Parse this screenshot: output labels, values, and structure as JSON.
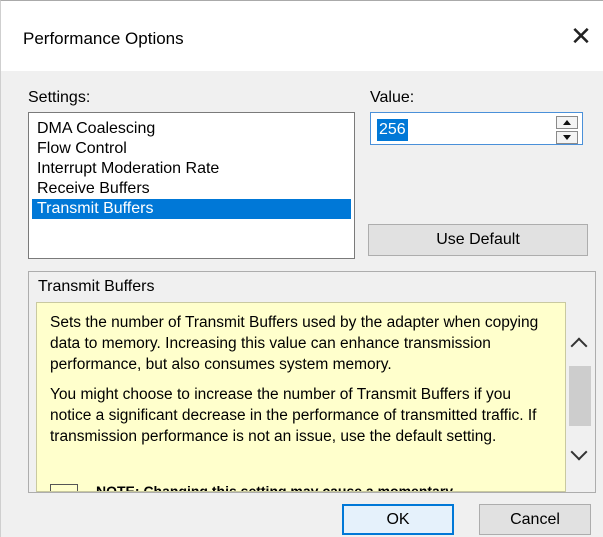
{
  "window": {
    "title": "Performance Options",
    "close_icon": "close-icon"
  },
  "settings": {
    "label": "Settings:",
    "items": [
      "DMA Coalescing",
      "Flow Control",
      "Interrupt Moderation Rate",
      "Receive Buffers",
      "Transmit Buffers"
    ],
    "selected": "Transmit Buffers"
  },
  "value": {
    "label": "Value:",
    "current": "256"
  },
  "buttons": {
    "use_default": "Use Default",
    "ok": "OK",
    "cancel": "Cancel"
  },
  "description": {
    "title": "Transmit Buffers",
    "paragraph1": "Sets the number of Transmit Buffers used by the adapter when copying data to memory. Increasing this value can enhance transmission performance, but also consumes system memory.",
    "paragraph2": "You might choose to increase the number of Transmit Buffers if you notice a significant decrease in the performance of transmitted traffic. If transmission performance is not an issue, use the default setting.",
    "note": "NOTE: Changing this setting may cause a momentary"
  },
  "colors": {
    "selection": "#0078d7",
    "help_background": "#ffffcc"
  }
}
